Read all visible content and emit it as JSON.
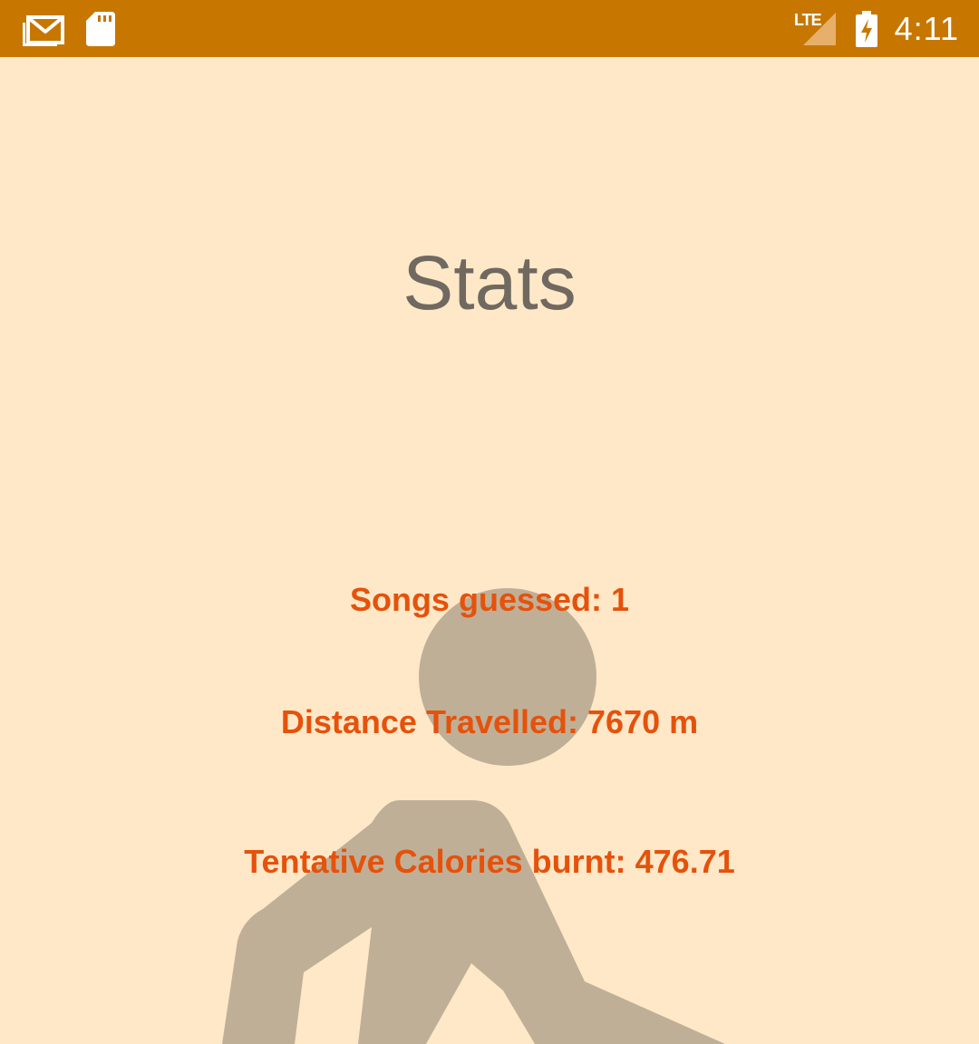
{
  "status_bar": {
    "time": "4:11",
    "network_label": "LTE",
    "icons": [
      "gmail-icon",
      "sd-card-icon",
      "lte-signal-icon",
      "battery-charging-icon"
    ],
    "background_color": "#C77700"
  },
  "page": {
    "title": "Stats",
    "background_color": "#FFE8C7",
    "illustration": "walking-person-icon"
  },
  "stats": {
    "songs_guessed": "Songs guessed: 1",
    "distance_travelled": "Distance Travelled: 7670 m",
    "calories_burnt": "Tentative Calories burnt: 476.71"
  },
  "colors": {
    "title": "#6F6960",
    "stat_text": "#E5520C",
    "illustration": "#C0AF97"
  }
}
